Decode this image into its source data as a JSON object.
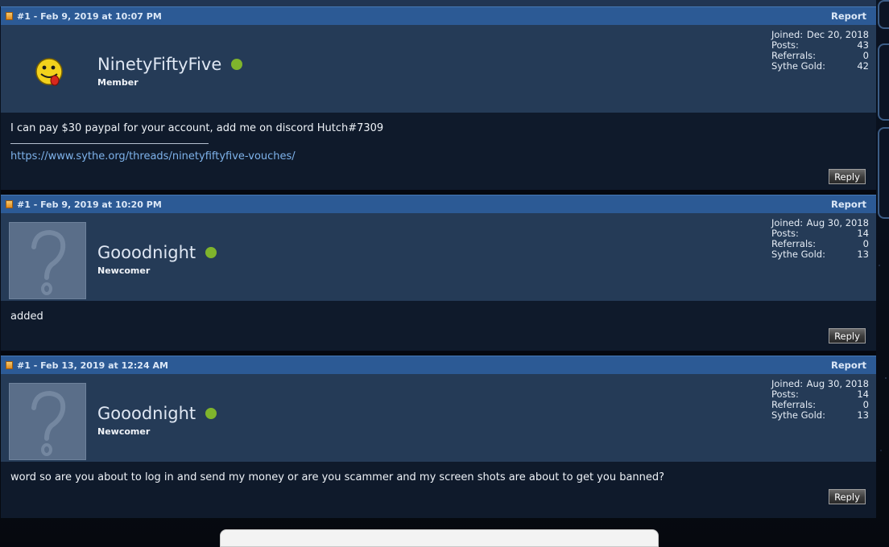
{
  "posts": [
    {
      "meta": "#1 - Feb 9, 2019 at 10:07 PM",
      "report": "Report",
      "username": "NinetyFiftyFive",
      "user_title": "Member",
      "avatar": "smiley-tongue-avatar",
      "stats": {
        "joined_label": "Joined:",
        "joined": "Dec 20, 2018",
        "posts_label": "Posts:",
        "posts": "43",
        "referrals_label": "Referrals:",
        "referrals": "0",
        "gold_label": "Sythe Gold:",
        "gold": "42"
      },
      "message": "I can pay $30 paypal for your account, add me on discord Hutch#7309",
      "signature_link": "https://www.sythe.org/threads/ninetyfiftyfive-vouches/",
      "reply": "Reply"
    },
    {
      "meta": "#1 - Feb 9, 2019 at 10:20 PM",
      "report": "Report",
      "username": "Gooodnight",
      "user_title": "Newcomer",
      "avatar": "default-question-avatar",
      "stats": {
        "joined_label": "Joined:",
        "joined": "Aug 30, 2018",
        "posts_label": "Posts:",
        "posts": "14",
        "referrals_label": "Referrals:",
        "referrals": "0",
        "gold_label": "Sythe Gold:",
        "gold": "13"
      },
      "message": "added",
      "reply": "Reply"
    },
    {
      "meta": "#1 - Feb 13, 2019 at 12:24 AM",
      "report": "Report",
      "username": "Gooodnight",
      "user_title": "Newcomer",
      "avatar": "default-question-avatar",
      "stats": {
        "joined_label": "Joined:",
        "joined": "Aug 30, 2018",
        "posts_label": "Posts:",
        "posts": "14",
        "referrals_label": "Referrals:",
        "referrals": "0",
        "gold_label": "Sythe Gold:",
        "gold": "13"
      },
      "message": "word so are you about to log in and send my money or are you scammer and my screen shots are about to get you banned?",
      "reply": "Reply"
    }
  ],
  "colors": {
    "header_blue": "#2c5a95",
    "user_panel": "#253b57",
    "body_dark": "#0f1a2b",
    "online_green": "#7fb42c",
    "link_blue": "#7eb2ea"
  }
}
